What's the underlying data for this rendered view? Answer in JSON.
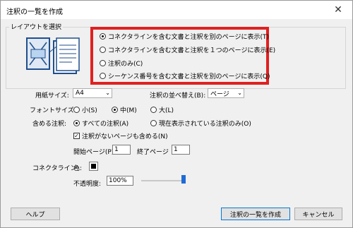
{
  "window": {
    "title": "注釈の一覧を作成",
    "close_glyph": "✕"
  },
  "layout_group": {
    "label": "レイアウトを選択",
    "options": [
      {
        "label": "コネクタラインを含む文書と注釈を別のページに表示(T)",
        "selected": true
      },
      {
        "label": "コネクタラインを含む文書と注釈を１つのページに表示(E)",
        "selected": false
      },
      {
        "label": "注釈のみ(C)",
        "selected": false
      },
      {
        "label": "シーケンス番号を含む文書と注釈を別のページに表示(Q)",
        "selected": false
      }
    ]
  },
  "paper_size": {
    "label": "用紙サイズ:",
    "value": "A4"
  },
  "sort": {
    "label": "注釈の並べ替え(B):",
    "value": "ページ"
  },
  "font_size": {
    "label": "フォントサイズ:",
    "options": [
      {
        "label": "小(S)",
        "selected": false
      },
      {
        "label": "中(M)",
        "selected": true
      },
      {
        "label": "大(L)",
        "selected": false
      }
    ]
  },
  "include": {
    "label": "含める注釈:",
    "options": [
      {
        "label": "すべての注釈(A)",
        "selected": true
      },
      {
        "label": "現在表示されている注釈のみ(O)",
        "selected": false
      }
    ]
  },
  "include_empty": {
    "label": "注釈がないページも含める(N)",
    "checked": true
  },
  "pages": {
    "start_label": "開始ページ(P)",
    "start_value": "1",
    "end_label": "終了ページ",
    "end_value": "1"
  },
  "connector": {
    "label": "コネクタライン:",
    "color_label": "色:",
    "opacity_label": "不透明度:",
    "opacity_value": "100%",
    "opacity_level": 1.0
  },
  "buttons": {
    "help": "ヘルプ",
    "create": "注釈の一覧を作成",
    "cancel": "キャンセル"
  },
  "colors": {
    "highlight_border": "#e02020",
    "slider_thumb": "#1e6bd6"
  }
}
